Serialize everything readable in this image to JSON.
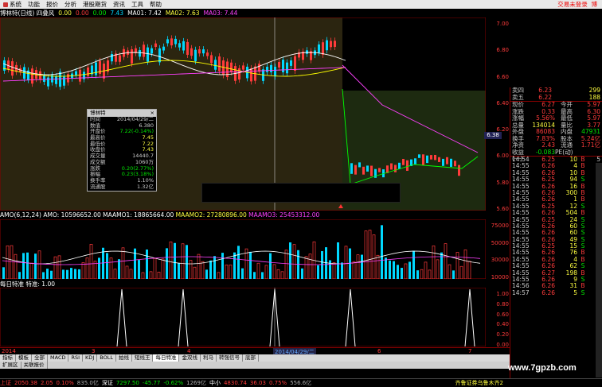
{
  "menu": {
    "items": [
      "系统",
      "功能",
      "报价",
      "分析",
      "港股期货",
      "资讯",
      "工具",
      "帮助"
    ],
    "login": "交易未登录",
    "extra": "博"
  },
  "info": {
    "name": "博林特(日线) 四叠风",
    "v1": "0.00",
    "v2": "0.00",
    "v3": "0.00",
    "v4": "7.43",
    "ma1": "MA01: 7.42",
    "ma2": "MA02: 7.63",
    "ma3": "MA03: 7.44"
  },
  "main_axis": [
    "7.00",
    "6.80",
    "6.60",
    "6.40",
    "6.20",
    "6.00",
    "5.80",
    "5.60"
  ],
  "amo": {
    "label": "AMO(6,12,24)",
    "amo": "AMO: 10596652.00",
    "m1": "MAAMO1: 18865664.00",
    "m2": "MAAMO2: 27280896.00",
    "m3": "MAAMO3: 25453312.00",
    "axis": [
      "75000",
      "50000",
      "30000",
      "10000"
    ]
  },
  "sig": {
    "label": "每日特准",
    "v": "特准: 1.00",
    "axis": [
      "1.00",
      "0.80",
      "0.60",
      "0.40",
      "0.20",
      "0.00"
    ]
  },
  "dates": {
    "a": "2014",
    "b": "3",
    "c": "4",
    "d": "2014/04/29/二",
    "e": "6",
    "f": "7"
  },
  "tooltip": {
    "title": "博林特",
    "rows": [
      [
        "时间",
        "2014/04/29/二"
      ],
      [
        "数值",
        "6.380"
      ],
      [
        "开盘价",
        "7.22(-0.14%)"
      ],
      [
        "最高价",
        "7.45"
      ],
      [
        "最低价",
        "7.22"
      ],
      [
        "收盘价",
        "7.43"
      ],
      [
        "成交量",
        "14440.7"
      ],
      [
        "成交额",
        "1060万"
      ],
      [
        "涨跌",
        "0.20(2.77%)"
      ],
      [
        "振幅",
        "0.23(3.18%)"
      ],
      [
        "换手率",
        "1.10%"
      ],
      [
        "流通股",
        "1.32亿"
      ]
    ]
  },
  "quote": {
    "ask": [
      [
        "卖四",
        "6.23",
        "299"
      ],
      [
        "卖五",
        "6.22",
        "188"
      ]
    ],
    "stats": [
      [
        "现价",
        "6.27",
        "今开",
        "5.97"
      ],
      [
        "涨跌",
        "0.33",
        "最高",
        "6.30"
      ],
      [
        "涨幅",
        "5.56%",
        "最低",
        "5.97"
      ],
      [
        "总量",
        "134014",
        "量比",
        "3.77"
      ],
      [
        "外盘",
        "86083",
        "内盘",
        "47931"
      ],
      [
        "换手",
        "7.83%",
        "股本",
        "5.24亿"
      ],
      [
        "净资",
        "2.43",
        "流通",
        "1.71亿"
      ],
      [
        "收益(一)",
        "-0.083",
        "PE(动)",
        ""
      ]
    ],
    "ticks": [
      [
        "14:54",
        "6.25",
        "10",
        "B",
        "5"
      ],
      [
        "14:55",
        "6.26",
        "4",
        "B",
        "1"
      ],
      [
        "14:55",
        "6.26",
        "10",
        "B",
        "3"
      ],
      [
        "14:55",
        "6.25",
        "94",
        "S",
        "3"
      ],
      [
        "14:55",
        "6.26",
        "16",
        "B",
        "4"
      ],
      [
        "14:55",
        "6.26",
        "300",
        "B",
        "7"
      ],
      [
        "14:55",
        "6.26",
        "1",
        "B",
        "1"
      ],
      [
        "14:55",
        "6.25",
        "12",
        "S",
        "3"
      ],
      [
        "14:55",
        "6.26",
        "504",
        "B",
        "6"
      ],
      [
        "14:55",
        "6.25",
        "24",
        "S",
        "5"
      ],
      [
        "14:55",
        "6.26",
        "60",
        "S",
        "2"
      ],
      [
        "14:55",
        "6.26",
        "60",
        "S",
        "4"
      ],
      [
        "14:55",
        "6.26",
        "49",
        "S",
        "6"
      ],
      [
        "14:55",
        "6.25",
        "15",
        "S",
        "2"
      ],
      [
        "14:55",
        "6.26",
        "76",
        "B",
        "4"
      ],
      [
        "14:55",
        "6.26",
        "4",
        "B",
        "1"
      ],
      [
        "14:55",
        "6.26",
        "62",
        "S",
        "5"
      ],
      [
        "14:55",
        "6.27",
        "198",
        "B",
        "6"
      ],
      [
        "14:55",
        "6.26",
        "9",
        "S",
        "1"
      ],
      [
        "14:56",
        "6.26",
        "31",
        "B",
        "4"
      ],
      [
        "14:57",
        "6.26",
        "5",
        "S",
        "1"
      ]
    ],
    "price_tag": "6.38"
  },
  "tabs": [
    "指标",
    "模板",
    "全部",
    "MACD",
    "RSI",
    "KDJ",
    "BOLL",
    "拍线",
    "短线王",
    "每日特准",
    "金双线",
    "利马",
    "转强信号",
    "底部"
  ],
  "tabs2": [
    "扩展区",
    "关联报价"
  ],
  "status": {
    "a": "上证",
    "av": "2050.38",
    "ac": "2.05",
    "ap": "0.10%",
    "aa": "835.0亿",
    "b": "深证",
    "bv": "7297.50",
    "bc": "-45.77",
    "bp": "-0.62%",
    "ba": "1269亿",
    "c": "中小",
    "cv": "4830.74",
    "cc": "36.03",
    "cp": "0.75%",
    "ca": "556.6亿",
    "d": "齐鲁证券乌鲁木齐2"
  },
  "watermark": "www.7gpzb.com",
  "colors": {
    "up": "#ff3b3b",
    "down": "#00d8ff",
    "ma1": "#ffffff",
    "ma2": "#ffff00",
    "ma3": "#ff40ff",
    "ma4": "#00ff00"
  }
}
